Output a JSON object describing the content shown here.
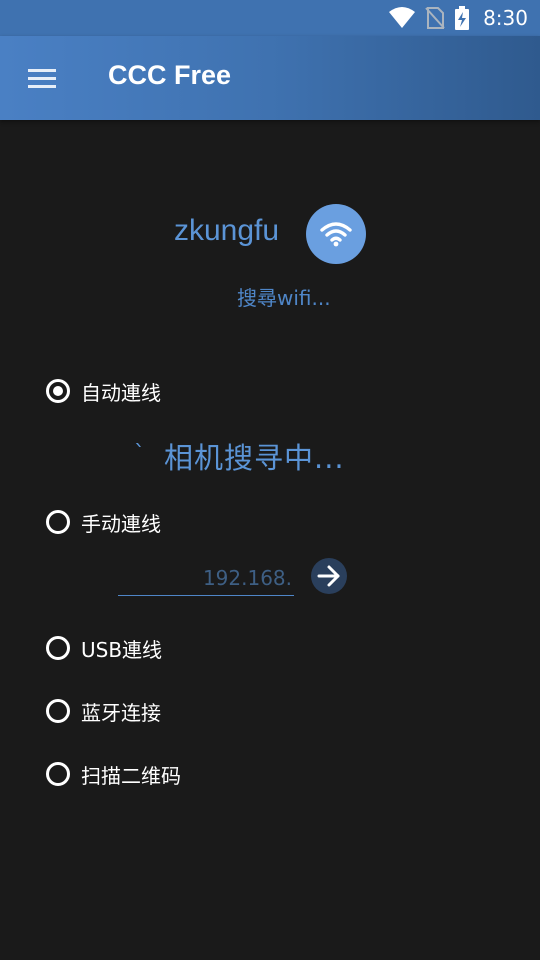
{
  "status_bar": {
    "time": "8:30",
    "icons": [
      "wifi-icon",
      "no-sim-icon",
      "battery-charging-icon"
    ]
  },
  "app_bar": {
    "title": "CCC Free",
    "menu_icon": "hamburger-menu-icon"
  },
  "wifi": {
    "network_name": "zkungfu",
    "status": "搜尋wifi...",
    "icon": "wifi-icon"
  },
  "options": {
    "auto": {
      "label": "自动連线",
      "checked": true
    },
    "auto_status": "相机搜寻中...",
    "manual": {
      "label": "手动連线",
      "checked": false
    },
    "ip_placeholder": "192.168.",
    "usb": {
      "label": "USB連线",
      "checked": false
    },
    "bluetooth": {
      "label": "蓝牙连接",
      "checked": false
    },
    "qrcode": {
      "label": "扫描二维码",
      "checked": false
    }
  },
  "colors": {
    "accent": "#4f86c8",
    "app_bar": "#3f72b0",
    "background": "#1a1a1a"
  }
}
